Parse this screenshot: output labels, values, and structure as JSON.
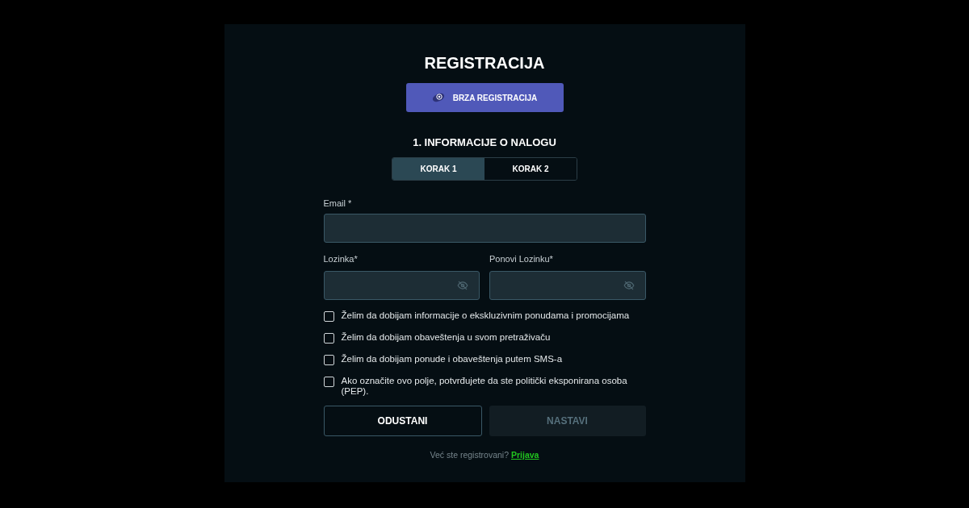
{
  "title": "REGISTRACIJA",
  "quick_button": {
    "label": "BRZA REGISTRACIJA"
  },
  "section_title": "1. INFORMACIJE O NALOGU",
  "steps": [
    {
      "label": "KORAK 1",
      "selected": true
    },
    {
      "label": "KORAK 2",
      "selected": false
    }
  ],
  "email": {
    "label": "Email *"
  },
  "password": {
    "label": "Lozinka*"
  },
  "repeat_password": {
    "label": "Ponovi Lozinku*"
  },
  "checkboxes": [
    {
      "label": "Želim da dobijam informacije o ekskluzivnim ponudama i promocijama",
      "checked": false
    },
    {
      "label": "Želim da dobijam obaveštenja u svom pretraživaču",
      "checked": false
    },
    {
      "label": "Želim da dobijam ponude i obaveštenja putem SMS-a",
      "checked": false
    },
    {
      "label": "Ako označite ovo polje, potvrđujete da ste politički eksponirana osoba (PEP).",
      "checked": false
    }
  ],
  "cancel_button": {
    "label": "ODUSTANI"
  },
  "continue_button": {
    "label": "NASTAVI",
    "disabled": true
  },
  "footer": {
    "text": "Već ste registrovani?",
    "link": "Prijava"
  }
}
